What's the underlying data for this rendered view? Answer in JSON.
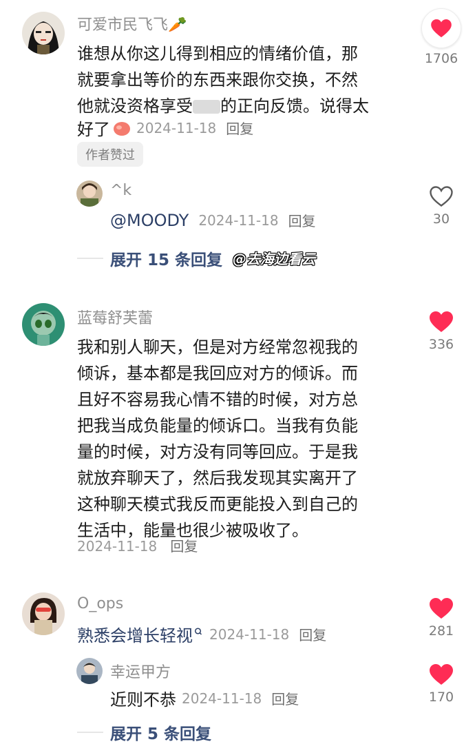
{
  "comments": [
    {
      "username": "可爱市民飞飞🥕",
      "lines": [
        "谁想从你这儿得到相应的情绪价值，那",
        "就要拿出等价的东西来跟你交换，不然",
        "他就没资格享受",
        "的正向反馈。说得太",
        "好了"
      ],
      "date": "2024-11-18",
      "reply_label": "回复",
      "likes": "1706",
      "author_badge": "作者赞过",
      "reply": {
        "username": "^k",
        "text": "@MOODY",
        "date": "2024-11-18",
        "reply_label": "回复",
        "likes": "30"
      },
      "expand_label": "展开 15 条回复",
      "watermark": "@去海边看云"
    },
    {
      "username": "蓝莓舒芙蕾",
      "lines": [
        "我和别人聊天，但是对方经常忽视我的",
        "倾诉，基本都是我回应对方的倾诉。而",
        "且好不容易我心情不错的时候，对方总",
        "把我当成负能量的倾诉口。当我有负能",
        "量的时候，对方没有同等回应。于是我",
        "就放弃聊天了，然后我发现其实离开了",
        "这种聊天模式我反而更能投入到自己的",
        "生活中，能量也很少被吸收了。"
      ],
      "date": "2024-11-18",
      "reply_label": "回复",
      "likes": "336"
    },
    {
      "username": "O_ops",
      "text": "熟悉会增长轻视",
      "date": "2024-11-18",
      "reply_label": "回复",
      "likes": "281",
      "reply": {
        "username": "幸运甲方",
        "text": "近则不恭",
        "date": "2024-11-18",
        "reply_label": "回复",
        "likes": "170"
      },
      "expand_label": "展开 5 条回复"
    }
  ],
  "colors": {
    "heart_red": "#fe2c55",
    "heart_outline": "#5a5a5a",
    "expand_blue": "#3a4f78"
  },
  "icons": [
    "heart-filled-icon",
    "heart-outline-icon",
    "search-glyph-icon"
  ]
}
